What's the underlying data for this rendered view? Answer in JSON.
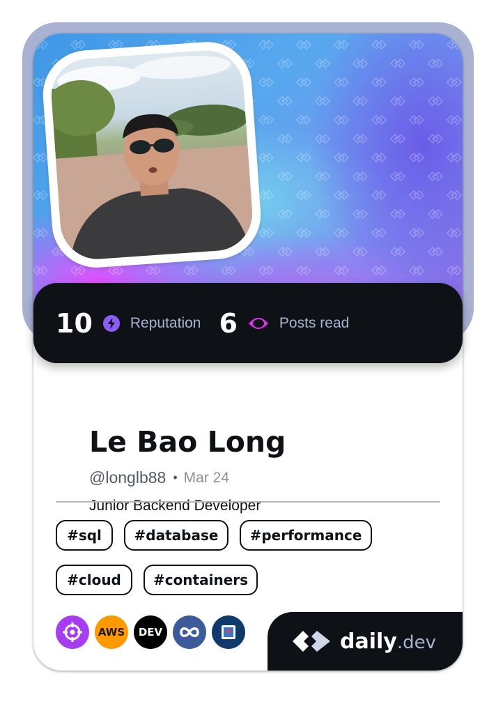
{
  "stats": {
    "reputation_value": "10",
    "reputation_label": "Reputation",
    "posts_value": "6",
    "posts_label": "Posts read"
  },
  "profile": {
    "name": "Le Bao Long",
    "handle": "@longlb88",
    "separator": "•",
    "joined": "Mar 24",
    "bio": "Junior Backend Developer"
  },
  "tags": [
    "#sql",
    "#database",
    "#performance",
    "#cloud",
    "#containers"
  ],
  "tools": [
    {
      "icon": "crosshair-icon",
      "color": "#a73df2"
    },
    {
      "icon": "aws-icon",
      "label": "AWS",
      "color": "#ff9900"
    },
    {
      "icon": "dev-icon",
      "label": "DEV",
      "color": "#000000"
    },
    {
      "icon": "infinity-icon",
      "color": "#3d5a9b"
    },
    {
      "icon": "jira-icon",
      "color": "#0f3a6b"
    }
  ],
  "brand": {
    "name": "daily",
    "suffix": ".dev"
  },
  "colors": {
    "reputation_icon": "#8c5cf7",
    "posts_icon": "#e02ef0",
    "card_bg": "#ffffff",
    "dark": "#0e1217",
    "frame": "#a9b2d2"
  }
}
